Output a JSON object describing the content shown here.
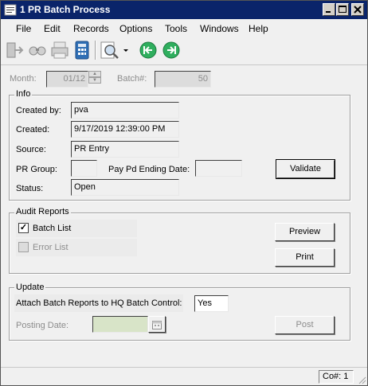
{
  "window": {
    "title": "1 PR Batch Process"
  },
  "menu": [
    "File",
    "Edit",
    "Records",
    "Options",
    "Tools",
    "Windows",
    "Help"
  ],
  "toolbar": {
    "icons": [
      "exit-icon",
      "find-icon",
      "print-icon",
      "calculator-icon",
      "preview-icon",
      "first-record-icon",
      "next-record-icon"
    ]
  },
  "header": {
    "month_label": "Month:",
    "month_value": "01/12",
    "batch_label": "Batch#:",
    "batch_value": "50"
  },
  "info": {
    "title": "Info",
    "created_by_label": "Created by:",
    "created_by_value": "pva",
    "created_label": "Created:",
    "created_value": "9/17/2019 12:39:00 PM",
    "source_label": "Source:",
    "source_value": "PR Entry",
    "pr_group_label": "PR Group:",
    "pr_group_value": "",
    "pay_pd_label": "Pay Pd Ending Date:",
    "pay_pd_value": "",
    "status_label": "Status:",
    "status_value": "Open",
    "validate_button": "Validate"
  },
  "audit": {
    "title": "Audit Reports",
    "batch_list_label": "Batch List",
    "batch_list_checked": true,
    "error_list_label": "Error List",
    "error_list_checked": false,
    "preview_button": "Preview",
    "print_button": "Print"
  },
  "update": {
    "title": "Update",
    "attach_label": "Attach Batch Reports to HQ Batch Control:",
    "attach_value": "Yes",
    "posting_date_label": "Posting Date:",
    "posting_date_value": "",
    "post_button": "Post"
  },
  "statusbar": {
    "company": "Co#: 1"
  }
}
